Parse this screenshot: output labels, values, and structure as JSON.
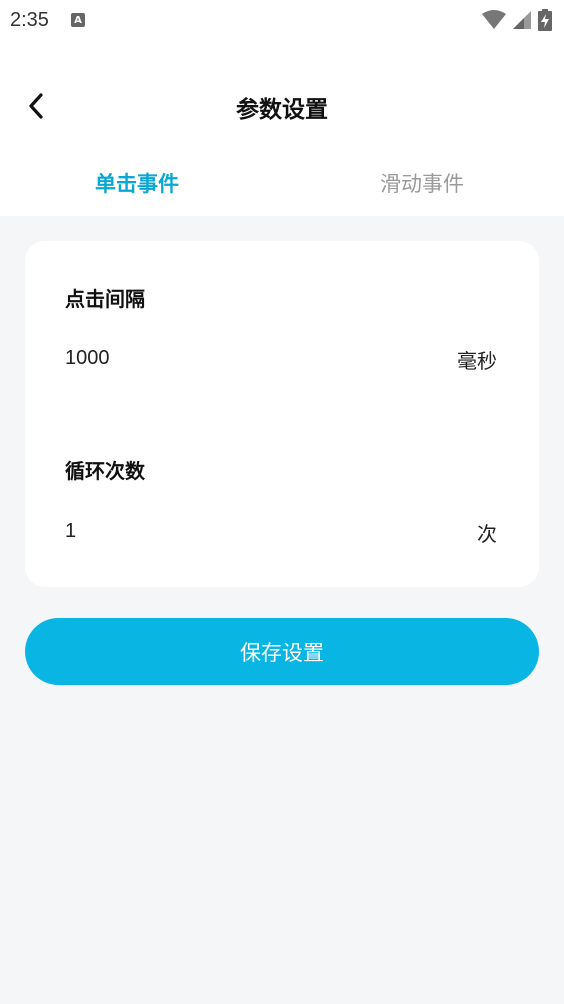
{
  "status_bar": {
    "time": "2:35",
    "notification_icon": "A"
  },
  "header": {
    "title": "参数设置",
    "back_icon": "chevron-left-icon"
  },
  "tabs": [
    {
      "label": "单击事件",
      "active": true
    },
    {
      "label": "滑动事件",
      "active": false
    }
  ],
  "form": {
    "interval": {
      "label": "点击间隔",
      "value": "1000",
      "unit": "毫秒"
    },
    "loop": {
      "label": "循环次数",
      "value": "1",
      "unit": "次"
    }
  },
  "save_label": "保存设置",
  "colors": {
    "accent": "#08b5e3",
    "active_tab": "#0aa7d4",
    "inactive_tab": "#9a9a9a",
    "background": "#f5f6f8"
  }
}
